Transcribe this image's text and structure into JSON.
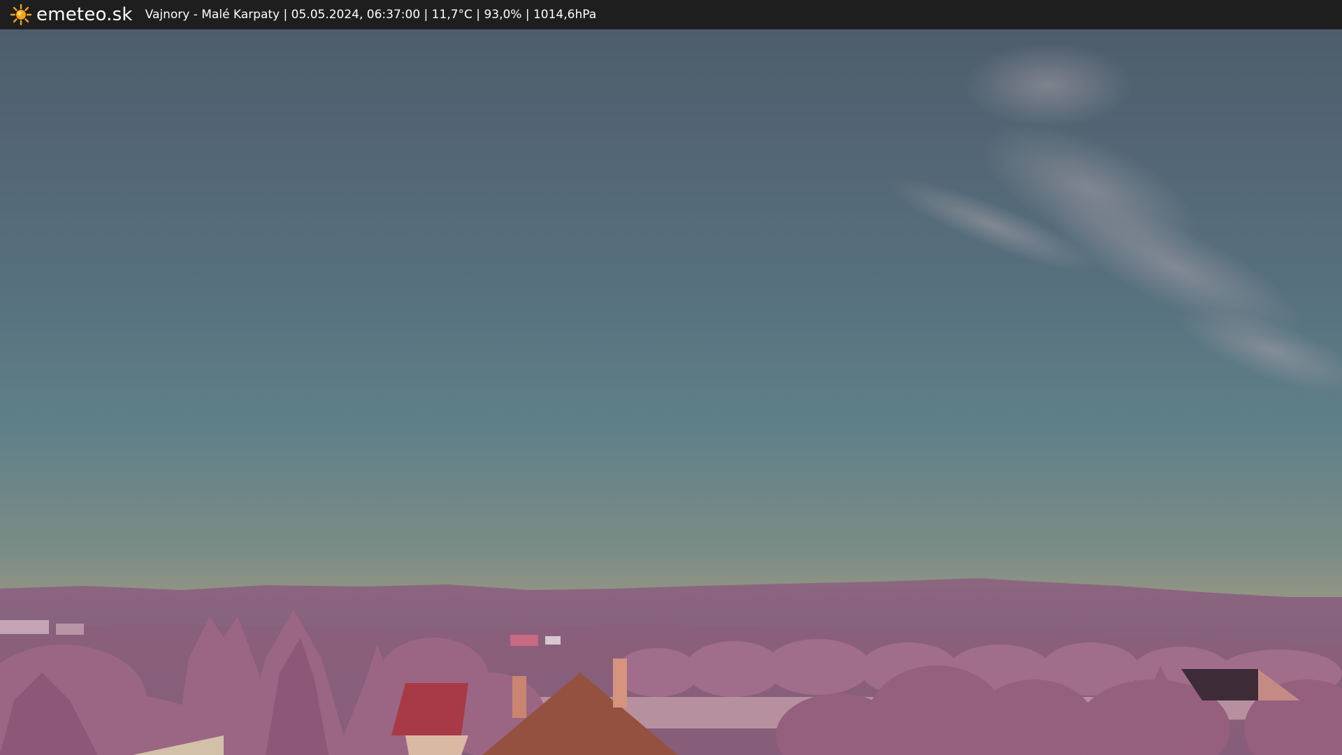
{
  "header": {
    "brand": "emeteo.sk",
    "info": "Vajnory - Malé Karpaty | 05.05.2024, 06:37:00 | 11,7°C | 93,0% | 1014,6hPa",
    "logo_icon": "sun-icon"
  },
  "colors": {
    "bar": "#1e1e1e",
    "sun": "#f5a31a",
    "sky_top": "#4f6070",
    "sky_mid": "#5e7f86",
    "horizon": "#a69a80",
    "foliage": "#9c6a86"
  }
}
